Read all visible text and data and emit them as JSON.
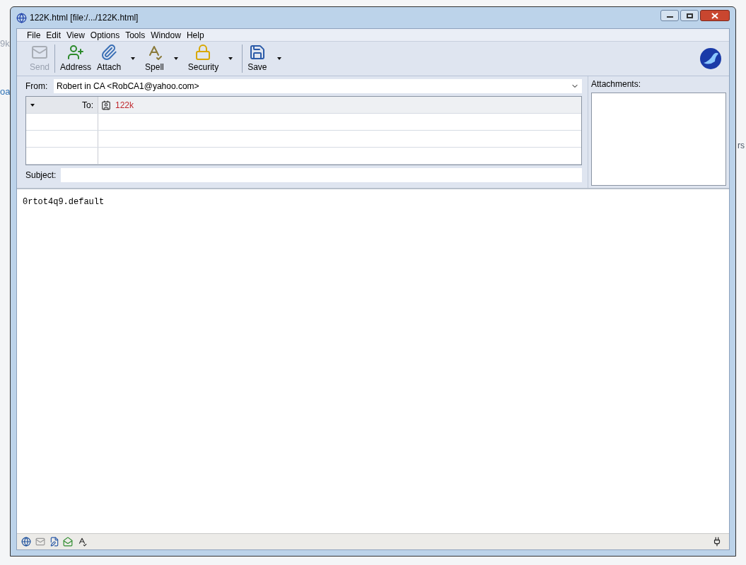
{
  "background": {
    "fragments": [
      "9k",
      "oa",
      "rs"
    ]
  },
  "window": {
    "title": "122K.html [file:/.../122K.html]"
  },
  "menu": [
    "File",
    "Edit",
    "View",
    "Options",
    "Tools",
    "Window",
    "Help"
  ],
  "toolbar": [
    {
      "kind": "send",
      "label": "Send",
      "disabled": true,
      "dropdown": false
    },
    {
      "kind": "address",
      "label": "Address",
      "disabled": false,
      "dropdown": false
    },
    {
      "kind": "attach",
      "label": "Attach",
      "disabled": false,
      "dropdown": true
    },
    {
      "kind": "spell",
      "label": "Spell",
      "disabled": false,
      "dropdown": true
    },
    {
      "kind": "security",
      "label": "Security",
      "disabled": false,
      "dropdown": true
    },
    {
      "kind": "save",
      "label": "Save",
      "disabled": false,
      "dropdown": true
    }
  ],
  "from": {
    "label": "From:",
    "value": "Robert in CA <RobCA1@yahoo.com>"
  },
  "recipients": [
    {
      "type": "To:",
      "address": "122k"
    }
  ],
  "subject": {
    "label": "Subject:"
  },
  "attachments": {
    "label": "Attachments:"
  },
  "body": {
    "text": "0rtot4q9.default"
  }
}
